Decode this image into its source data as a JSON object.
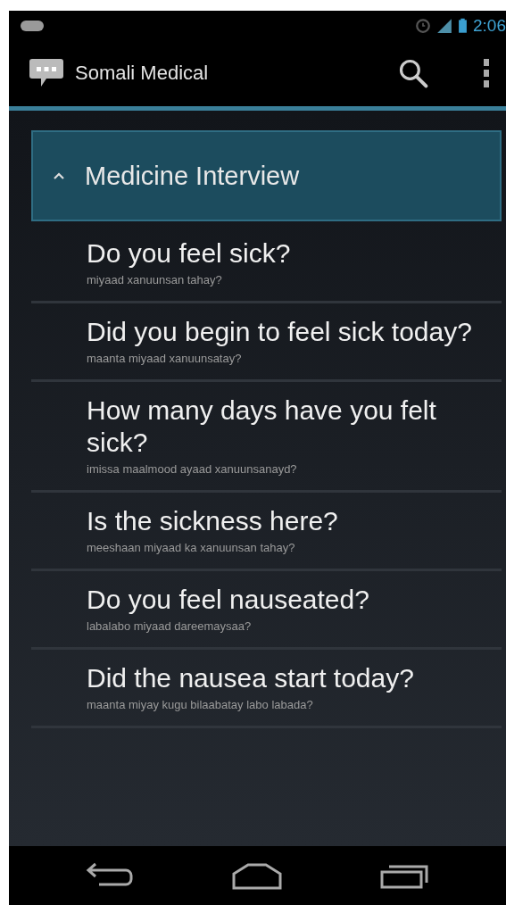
{
  "status_bar": {
    "time": "2:06"
  },
  "app_bar": {
    "title": "Somali Medical"
  },
  "group": {
    "label": "Medicine Interview",
    "expanded": true
  },
  "items": [
    {
      "question": "Do you feel sick?",
      "translation": "miyaad xanuunsan tahay?"
    },
    {
      "question": "Did you begin to feel sick today?",
      "translation": "maanta miyaad xanuunsatay?"
    },
    {
      "question": "How many days have you felt sick?",
      "translation": "imissa maalmood ayaad xanuunsanayd?"
    },
    {
      "question": "Is the sickness here?",
      "translation": "meeshaan miyaad ka xanuunsan tahay?"
    },
    {
      "question": "Do you feel nauseated?",
      "translation": "labalabo miyaad dareemaysaa?"
    },
    {
      "question": "Did the nausea start today?",
      "translation": "maanta miyay kugu bilaabatay labo labada?"
    }
  ]
}
